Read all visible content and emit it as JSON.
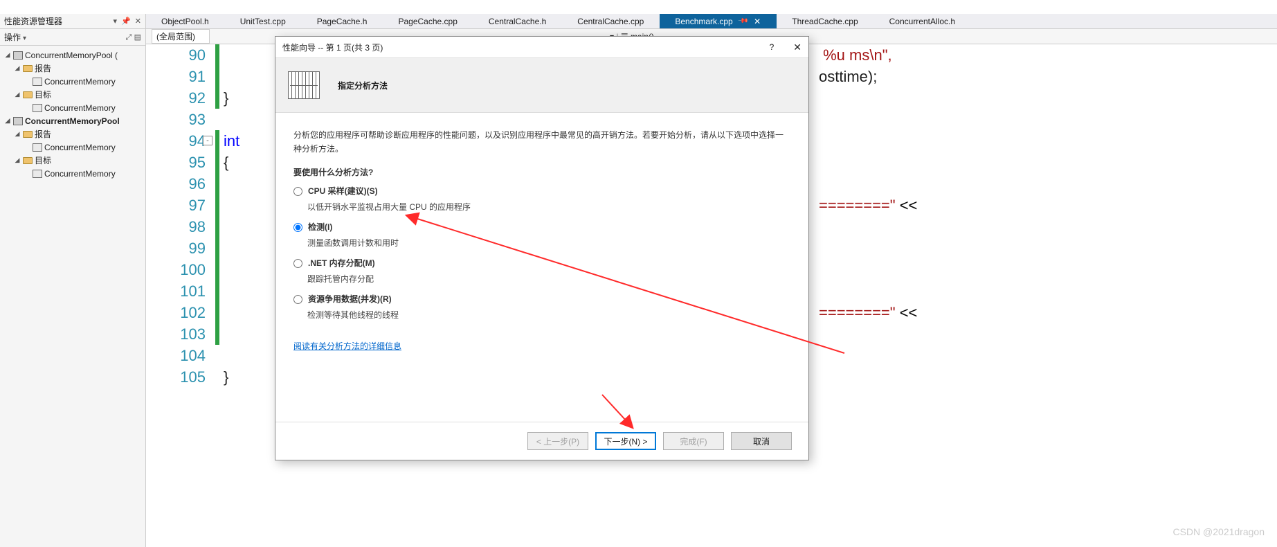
{
  "left_panel": {
    "title": "性能资源管理器",
    "subtitle": "操作",
    "tree": [
      {
        "label": "ConcurrentMemoryPool (",
        "depth": 0,
        "arrow": "▸",
        "bold": false,
        "icon": "mem"
      },
      {
        "label": "报告",
        "depth": 1,
        "arrow": "▸",
        "bold": false,
        "icon": "folder"
      },
      {
        "label": "ConcurrentMemory",
        "depth": 2,
        "arrow": "",
        "bold": false,
        "icon": "mem2"
      },
      {
        "label": "目标",
        "depth": 1,
        "arrow": "▸",
        "bold": false,
        "icon": "folder"
      },
      {
        "label": "ConcurrentMemory",
        "depth": 2,
        "arrow": "",
        "bold": false,
        "icon": "mem2"
      },
      {
        "label": "ConcurrentMemoryPool",
        "depth": 0,
        "arrow": "▸",
        "bold": true,
        "icon": "mem"
      },
      {
        "label": "报告",
        "depth": 1,
        "arrow": "▸",
        "bold": false,
        "icon": "folder"
      },
      {
        "label": "ConcurrentMemory",
        "depth": 2,
        "arrow": "",
        "bold": false,
        "icon": "mem2"
      },
      {
        "label": "目标",
        "depth": 1,
        "arrow": "▸",
        "bold": false,
        "icon": "folder"
      },
      {
        "label": "ConcurrentMemory",
        "depth": 2,
        "arrow": "",
        "bold": false,
        "icon": "mem2"
      }
    ]
  },
  "tabs": [
    {
      "label": "ObjectPool.h",
      "active": false
    },
    {
      "label": "UnitTest.cpp",
      "active": false
    },
    {
      "label": "PageCache.h",
      "active": false
    },
    {
      "label": "PageCache.cpp",
      "active": false
    },
    {
      "label": "CentralCache.h",
      "active": false
    },
    {
      "label": "CentralCache.cpp",
      "active": false
    },
    {
      "label": "Benchmark.cpp",
      "active": true,
      "pin": true,
      "close": true
    },
    {
      "label": "ThreadCache.cpp",
      "active": false
    },
    {
      "label": "ConcurrentAlloc.h",
      "active": false
    }
  ],
  "subbar": {
    "combo1": "(全局范围)",
    "combo2": "main()"
  },
  "code": {
    "start": 90,
    "end": 105,
    "lines": {
      "90": "",
      "91": "",
      "92": "}",
      "93": "",
      "94_pre": "int ",
      "95": "{",
      "105": "}"
    },
    "right_frag1": " %u ms\\n\",",
    "right_frag2": "osttime);",
    "right_eq1": "========\"",
    "right_op": " <<",
    "right_eq2": "========\"",
    "right_op2": " <<"
  },
  "wizard": {
    "title": "性能向导 -- 第 1 页(共 3 页)",
    "heading": "指定分析方法",
    "intro": "分析您的应用程序可帮助诊断应用程序的性能问题，以及识别应用程序中最常见的高开销方法。若要开始分析，请从以下选项中选择一种分析方法。",
    "question": "要使用什么分析方法?",
    "options": [
      {
        "label": "CPU 采样(建议)(S)",
        "desc": "以低开销水平监视占用大量 CPU 的应用程序",
        "checked": false
      },
      {
        "label": "检测(I)",
        "desc": "测量函数调用计数和用时",
        "checked": true
      },
      {
        "label": ".NET 内存分配(M)",
        "desc": "跟踪托管内存分配",
        "checked": false
      },
      {
        "label": "资源争用数据(并发)(R)",
        "desc": "检测等待其他线程的线程",
        "checked": false
      }
    ],
    "link": "阅读有关分析方法的详细信息",
    "buttons": {
      "prev": "< 上一步(P)",
      "next": "下一步(N) >",
      "finish": "完成(F)",
      "cancel": "取消"
    }
  },
  "watermark": "CSDN @2021dragon"
}
